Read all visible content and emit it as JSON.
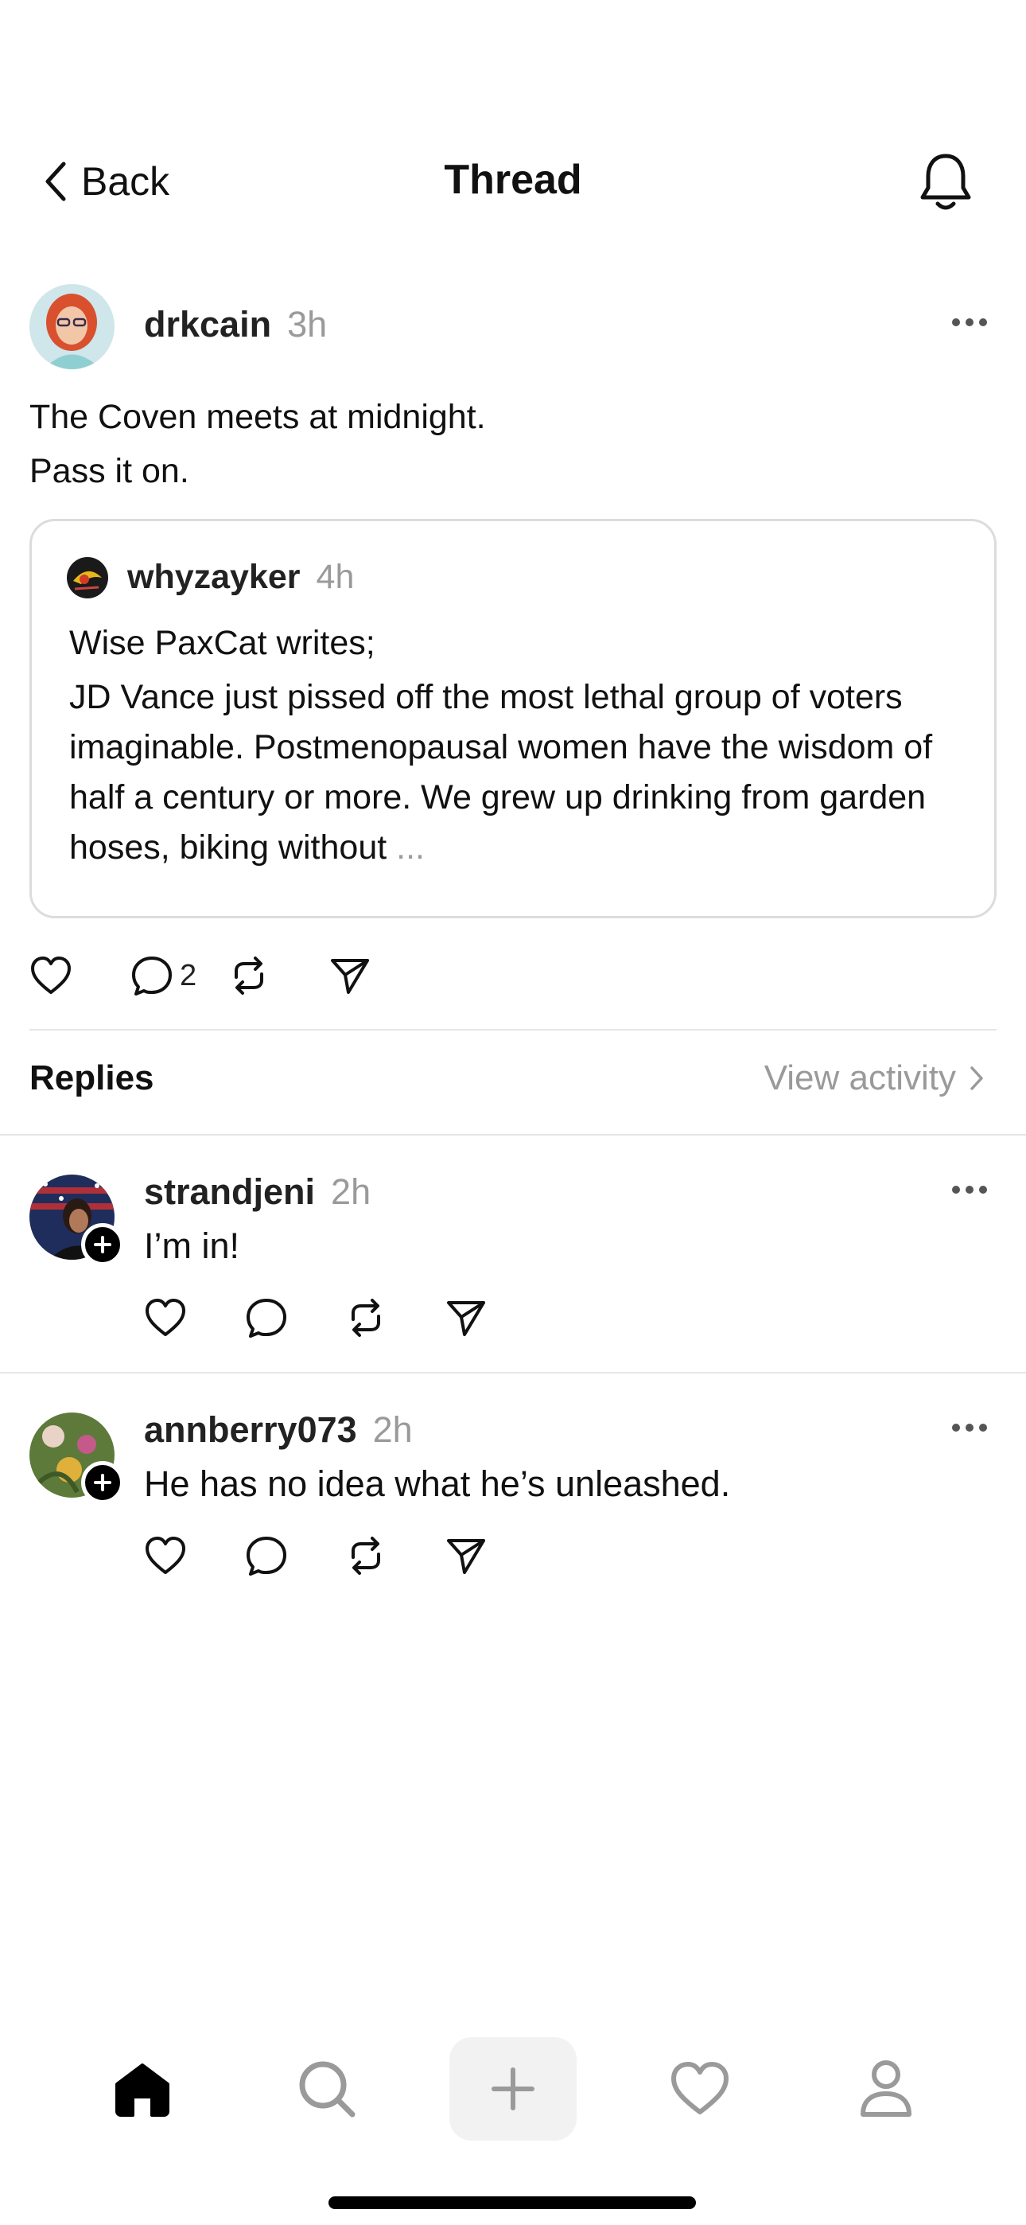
{
  "header": {
    "back_label": "Back",
    "title": "Thread"
  },
  "post": {
    "username": "drkcain",
    "time": "3h",
    "text_line1": "The Coven meets at midnight.",
    "text_line2": "Pass it on.",
    "quote": {
      "username": "whyzayker",
      "time": "4h",
      "line1": "Wise PaxCat writes;",
      "body": "JD Vance just pissed off the most lethal group of voters imaginable. Postmenopausal women have the wisdom of half a century or more. We grew up drinking from garden hoses, biking without",
      "ellipsis": "..."
    },
    "reply_count": "2"
  },
  "replies_section": {
    "label": "Replies",
    "view_activity": "View activity"
  },
  "replies": [
    {
      "username": "strandjeni",
      "time": "2h",
      "text": "I’m in!"
    },
    {
      "username": "annberry073",
      "time": "2h",
      "text": "He has no idea what he’s unleashed."
    }
  ],
  "colors": {
    "text": "#111111",
    "muted": "#9a9a9a",
    "divider": "#e6e6e6",
    "card_border": "#dcdcdc"
  },
  "icons": {
    "back": "chevron-left-icon",
    "bell": "bell-icon",
    "more": "more-horizontal-icon",
    "like": "heart-icon",
    "reply": "comment-icon",
    "repost": "repost-icon",
    "share": "send-icon",
    "home": "home-icon",
    "search": "search-icon",
    "create": "plus-icon",
    "activity": "heart-icon",
    "profile": "person-icon"
  }
}
